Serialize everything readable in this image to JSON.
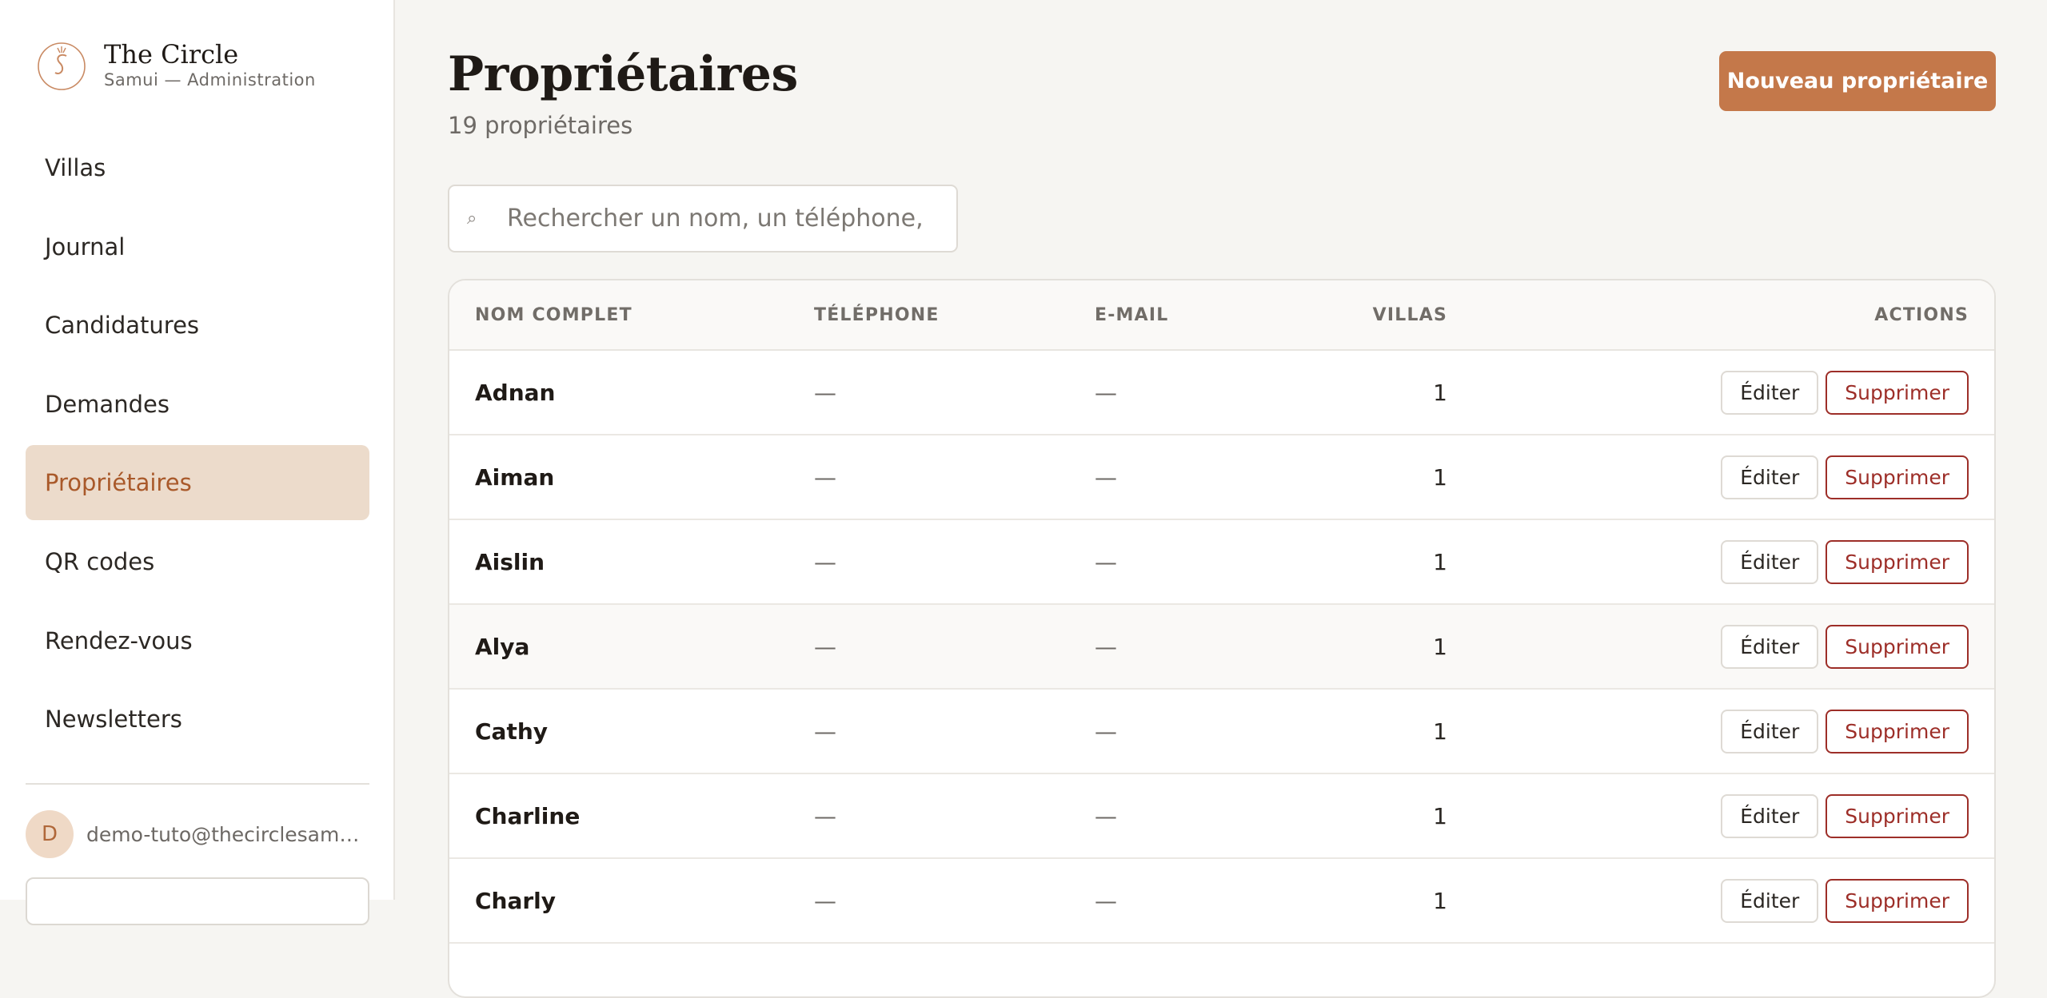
{
  "brand": {
    "title": "The Circle",
    "subtitle": "Samui — Administration"
  },
  "nav": {
    "items": [
      {
        "label": "Villas",
        "active": false
      },
      {
        "label": "Journal",
        "active": false
      },
      {
        "label": "Candidatures",
        "active": false
      },
      {
        "label": "Demandes",
        "active": false
      },
      {
        "label": "Propriétaires",
        "active": true
      },
      {
        "label": "QR codes",
        "active": false
      },
      {
        "label": "Rendez-vous",
        "active": false
      },
      {
        "label": "Newsletters",
        "active": false
      }
    ]
  },
  "user": {
    "initial": "D",
    "email": "demo-tuto@thecirclesamui.c..."
  },
  "page": {
    "title": "Propriétaires",
    "count": "19 propriétaires",
    "new_button": "Nouveau propriétaire"
  },
  "search": {
    "placeholder": "Rechercher un nom, un téléphone, un e-mail..."
  },
  "table": {
    "headers": {
      "name": "NOM COMPLET",
      "phone": "TÉLÉPHONE",
      "email": "E-MAIL",
      "villas": "VILLAS",
      "actions": "ACTIONS"
    },
    "edit_label": "Éditer",
    "delete_label": "Supprimer",
    "rows": [
      {
        "name": "Adnan",
        "phone": "—",
        "email": "—",
        "villas": "1"
      },
      {
        "name": "Aiman",
        "phone": "—",
        "email": "—",
        "villas": "1"
      },
      {
        "name": "Aislin",
        "phone": "—",
        "email": "—",
        "villas": "1"
      },
      {
        "name": "Alya",
        "phone": "—",
        "email": "—",
        "villas": "1"
      },
      {
        "name": "Cathy",
        "phone": "—",
        "email": "—",
        "villas": "1"
      },
      {
        "name": "Charline",
        "phone": "—",
        "email": "—",
        "villas": "1"
      },
      {
        "name": "Charly",
        "phone": "—",
        "email": "—",
        "villas": "1"
      }
    ]
  },
  "colors": {
    "accent": "#c4784a",
    "active_bg": "#ecdbcb",
    "danger": "#9d2e28"
  }
}
